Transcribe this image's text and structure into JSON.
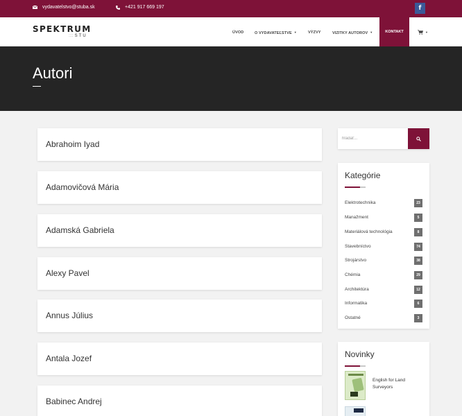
{
  "topbar": {
    "email": "vydavatelstvo@stuba.sk",
    "phone": "+421 917 669 197",
    "facebook_glyph": "f",
    "icons": {
      "email": "envelope-icon",
      "phone": "phone-icon",
      "facebook": "facebook-icon"
    },
    "color": "#7e1238"
  },
  "logo": {
    "main": "SPEKTRUM",
    "sub": "STU",
    "sub_dots": "::::"
  },
  "nav": {
    "items": [
      "ÚVOD",
      "O VYDAVATEĽSTVE",
      "VÝZVY",
      "VIZITKY AUTOROV",
      "KONTAKT"
    ],
    "active": "KONTAKT",
    "cart_icon": "cart-icon"
  },
  "page": {
    "title": "Autori"
  },
  "authors": [
    "Abrahoim Iyad",
    "Adamovičová Mária",
    "Adamská Gabriela",
    "Alexy Pavel",
    "Annus Július",
    "Antala Jozef",
    "Babinec Andrej"
  ],
  "search": {
    "placeholder": "hľadať...",
    "button_icon": "search-icon"
  },
  "categories": {
    "title": "Kategórie",
    "items": [
      {
        "label": "Elektrotechnika",
        "count": "23"
      },
      {
        "label": "Manažment",
        "count": "5"
      },
      {
        "label": "Materiálová technológia",
        "count": "8"
      },
      {
        "label": "Stavebníctvo",
        "count": "74"
      },
      {
        "label": "Strojárstvo",
        "count": "38"
      },
      {
        "label": "Chémia",
        "count": "29"
      },
      {
        "label": "Architektúra",
        "count": "12"
      },
      {
        "label": "Informatika",
        "count": "6"
      },
      {
        "label": "Ostatné",
        "count": "3"
      }
    ]
  },
  "news": {
    "title": "Novinky",
    "items": [
      {
        "title": "English for Land Surveyors"
      }
    ]
  }
}
